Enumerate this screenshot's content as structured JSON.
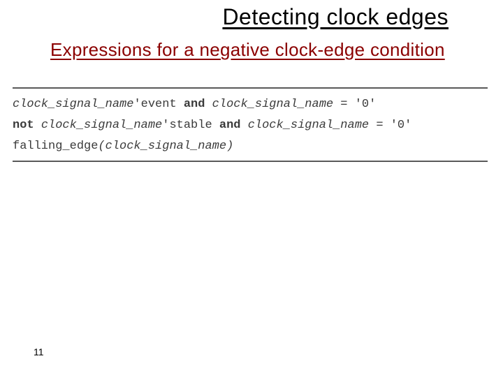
{
  "title": "Detecting clock edges",
  "subtitle": "Expressions for a negative clock-edge condition",
  "code": {
    "line1": {
      "sig1": "clock_signal_name",
      "attr1": "'event",
      "kw_and": "and",
      "sig2": "clock_signal_name",
      "eq": " = '0'"
    },
    "line2": {
      "kw_not": "not",
      "sig1": "clock_signal_name",
      "attr1": "'stable",
      "kw_and": "and",
      "sig2": "clock_signal_name",
      "eq": " = '0'"
    },
    "line3": {
      "fn": "falling_edge",
      "open": "(",
      "sig": "clock_signal_name",
      "close": ")"
    }
  },
  "page_number": "11"
}
